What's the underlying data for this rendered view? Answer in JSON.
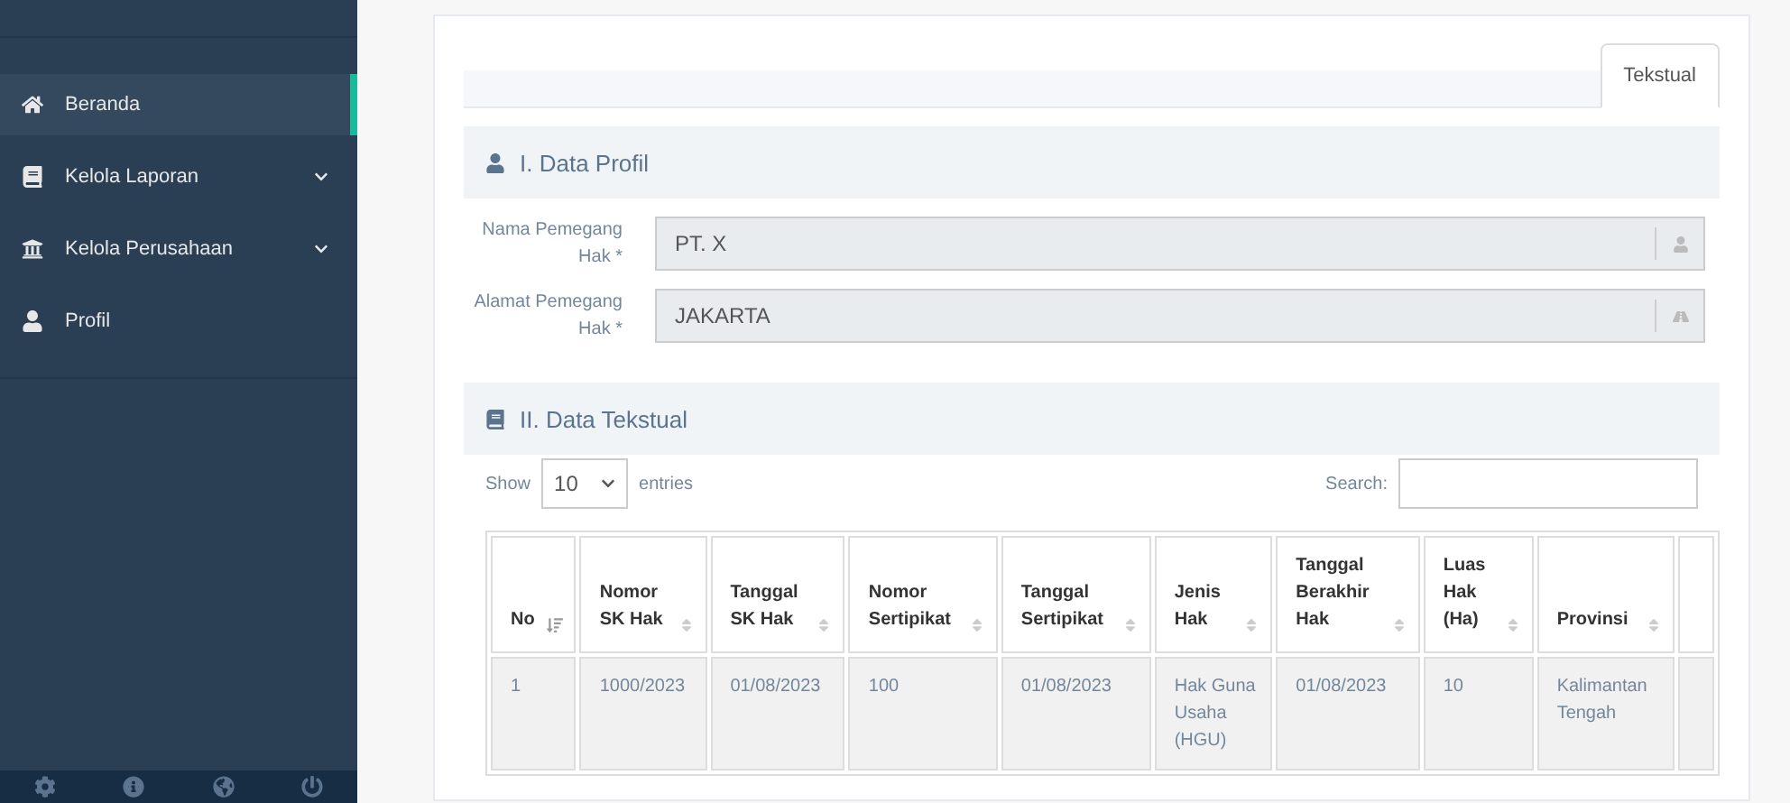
{
  "sidebar": {
    "items": [
      {
        "label": "Beranda",
        "selected": true,
        "expandable": false
      },
      {
        "label": "Kelola Laporan",
        "selected": false,
        "expandable": true
      },
      {
        "label": "Kelola Perusahaan",
        "selected": false,
        "expandable": true
      },
      {
        "label": "Profil",
        "selected": false,
        "expandable": false
      }
    ]
  },
  "tabs": [
    {
      "label": "Tekstual",
      "selected": true
    }
  ],
  "profile_section": {
    "title": "I. Data Profil",
    "fields": [
      {
        "label": "Nama Pemegang Hak *",
        "value": "PT. X"
      },
      {
        "label": "Alamat Pemegang Hak *",
        "value": "JAKARTA"
      }
    ]
  },
  "textual_section": {
    "title": "II. Data Tekstual",
    "length_menu": {
      "prefix": "Show",
      "value": "10",
      "suffix": "entries"
    },
    "search": {
      "label": "Search:"
    },
    "table": {
      "columns": [
        {
          "label": "No",
          "sorted": true
        },
        {
          "label": "Nomor SK Hak",
          "sorted": false
        },
        {
          "label": "Tanggal SK Hak",
          "sorted": false
        },
        {
          "label": "Nomor Sertipikat",
          "sorted": false
        },
        {
          "label": "Tanggal Sertipikat",
          "sorted": false
        },
        {
          "label": "Jenis Hak",
          "sorted": false
        },
        {
          "label": "Tanggal Berakhir Hak",
          "sorted": false
        },
        {
          "label": "Luas Hak (Ha)",
          "sorted": false
        },
        {
          "label": "Provinsi",
          "sorted": false
        }
      ],
      "rows": [
        [
          "1",
          "1000/2023",
          "01/08/2023",
          "100",
          "01/08/2023",
          "Hak Guna Usaha (HGU)",
          "01/08/2023",
          "10",
          "Kalimantan Tengah"
        ]
      ]
    }
  }
}
